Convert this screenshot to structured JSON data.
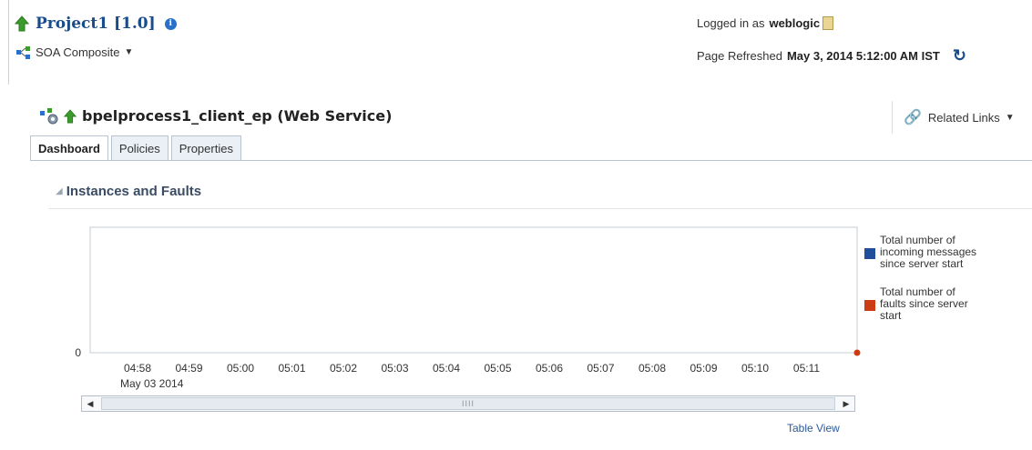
{
  "header": {
    "title": "Project1 [1.0]",
    "subtitle": "SOA Composite",
    "logged_in_label": "Logged in as",
    "username": "weblogic",
    "refreshed_label": "Page Refreshed",
    "refreshed_time": "May 3, 2014 5:12:00 AM IST"
  },
  "service": {
    "title": "bpelprocess1_client_ep (Web Service)",
    "related_links": "Related Links"
  },
  "tabs": [
    {
      "label": "Dashboard",
      "active": true
    },
    {
      "label": "Policies",
      "active": false
    },
    {
      "label": "Properties",
      "active": false
    }
  ],
  "section": {
    "title": "Instances and Faults"
  },
  "chart_data": {
    "type": "line",
    "title": "",
    "x": [
      "04:58",
      "04:59",
      "05:00",
      "05:01",
      "05:02",
      "05:03",
      "05:04",
      "05:05",
      "05:06",
      "05:07",
      "05:08",
      "05:09",
      "05:10",
      "05:11"
    ],
    "x_sublabel": "May 03 2014",
    "ylabel": "",
    "y_tick": "0",
    "ylim": [
      0,
      1
    ],
    "series": [
      {
        "name": "Total number of incoming messages since server start",
        "color": "#1f4e9b",
        "values": []
      },
      {
        "name": "Total number of faults since server start",
        "color": "#cc3b12",
        "values": [
          0
        ]
      }
    ]
  },
  "legend": [
    {
      "lines": [
        "Total number of",
        "incoming messages",
        "since server start"
      ],
      "color": "#1f4e9b"
    },
    {
      "lines": [
        "Total number of",
        "faults since server",
        "start"
      ],
      "color": "#cc3b12"
    }
  ],
  "footer": {
    "table_view": "Table View"
  },
  "scrollbar": {
    "grip": "IIII"
  }
}
